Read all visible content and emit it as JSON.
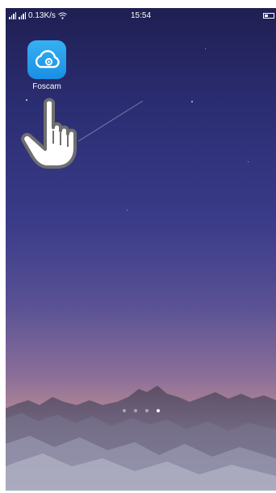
{
  "status_bar": {
    "network_speed": "0.13K/s",
    "time": "15:54",
    "signal_label": "⅘il"
  },
  "home_screen": {
    "apps": [
      {
        "label": "Foscam",
        "icon": "cloud-camera-icon",
        "color": "#1a8fe3"
      }
    ],
    "page_count": 4,
    "active_page": 4
  },
  "overlay": {
    "hint_icon": "hand-pointer-icon"
  }
}
